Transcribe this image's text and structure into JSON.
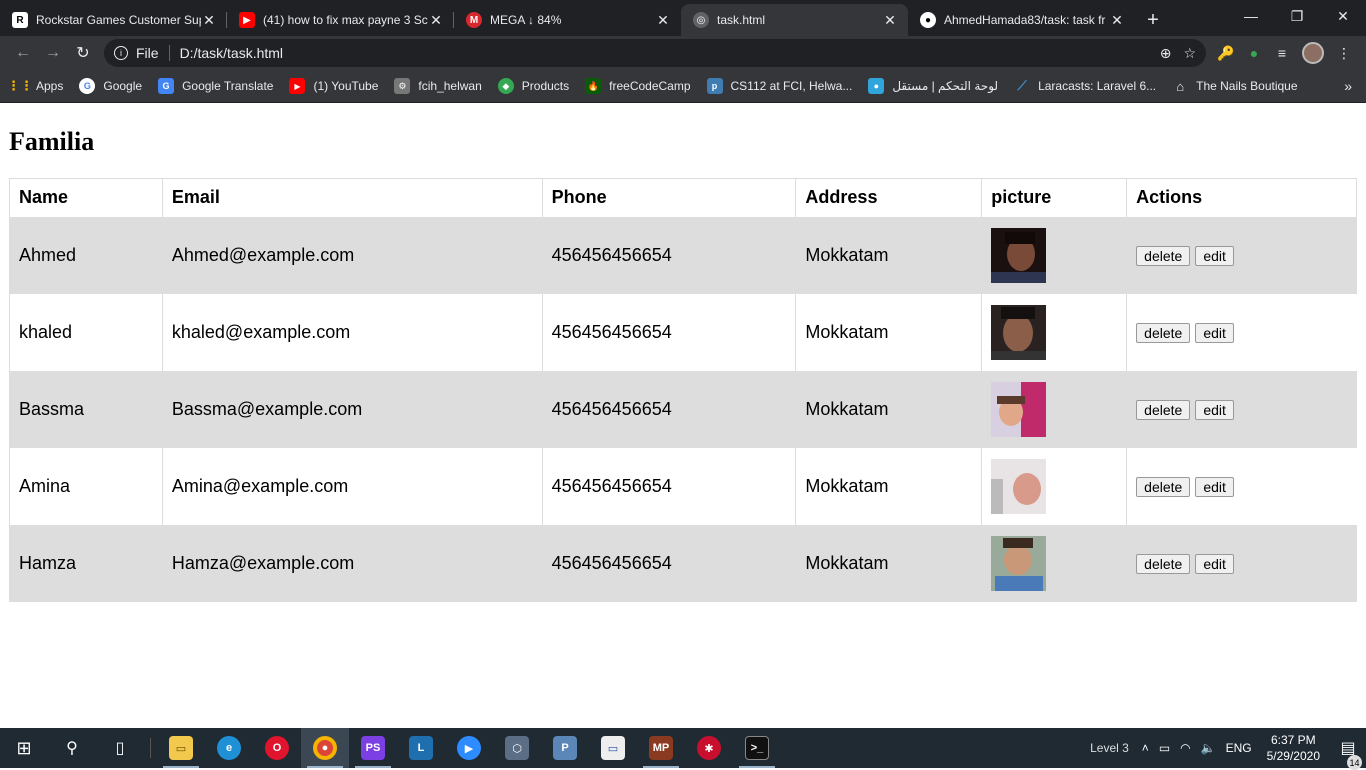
{
  "browser": {
    "tabs": [
      {
        "title": "Rockstar Games Customer Sup",
        "icon": "rockstar-icon",
        "color": "#ffffff",
        "active": false
      },
      {
        "title": "(41) how to fix max payne 3 Sc",
        "icon": "youtube-icon",
        "color": "#ff0000",
        "active": false
      },
      {
        "title": "MEGA ↓ 84%",
        "icon": "mega-icon",
        "color": "#d9272e",
        "active": false
      },
      {
        "title": "task.html",
        "icon": "globe-icon",
        "color": "#9aa0a6",
        "active": true
      },
      {
        "title": "AhmedHamada83/task: task fr",
        "icon": "github-icon",
        "color": "#ffffff",
        "active": false
      }
    ],
    "address": {
      "scheme": "File",
      "url": "D:/task/task.html"
    },
    "bookmarks": [
      {
        "label": "Apps",
        "icon": "apps-grid-icon"
      },
      {
        "label": "Google",
        "icon": "google-icon"
      },
      {
        "label": "Google Translate",
        "icon": "translate-icon"
      },
      {
        "label": "(1) YouTube",
        "icon": "youtube-icon"
      },
      {
        "label": "fcih_helwan",
        "icon": "fcih-icon"
      },
      {
        "label": "Products",
        "icon": "products-icon"
      },
      {
        "label": "freeCodeCamp",
        "icon": "freecodecamp-icon"
      },
      {
        "label": "CS112 at FCI, Helwa...",
        "icon": "piazza-icon"
      },
      {
        "label": "لوحة التحكم | مستقل",
        "icon": "mostaql-icon"
      },
      {
        "label": "Laracasts: Laravel 6...",
        "icon": "laracasts-icon"
      },
      {
        "label": "The Nails Boutique",
        "icon": "house-icon"
      }
    ]
  },
  "page": {
    "heading": "Familia",
    "columns": [
      "Name",
      "Email",
      "Phone",
      "Address",
      "picture",
      "Actions"
    ],
    "rows": [
      {
        "name": "Ahmed",
        "email": "Ahmed@example.com",
        "phone": "456456456654",
        "address": "Mokkatam",
        "delete": "delete",
        "edit": "edit"
      },
      {
        "name": "khaled",
        "email": "khaled@example.com",
        "phone": "456456456654",
        "address": "Mokkatam",
        "delete": "delete",
        "edit": "edit"
      },
      {
        "name": "Bassma",
        "email": "Bassma@example.com",
        "phone": "456456456654",
        "address": "Mokkatam",
        "delete": "delete",
        "edit": "edit"
      },
      {
        "name": "Amina",
        "email": "Amina@example.com",
        "phone": "456456456654",
        "address": "Mokkatam",
        "delete": "delete",
        "edit": "edit"
      },
      {
        "name": "Hamza",
        "email": "Hamza@example.com",
        "phone": "456456456654",
        "address": "Mokkatam",
        "delete": "delete",
        "edit": "edit"
      }
    ]
  },
  "taskbar": {
    "level": "Level 3",
    "language": "ENG",
    "time": "6:37 PM",
    "date": "5/29/2020",
    "notifications": "14"
  }
}
